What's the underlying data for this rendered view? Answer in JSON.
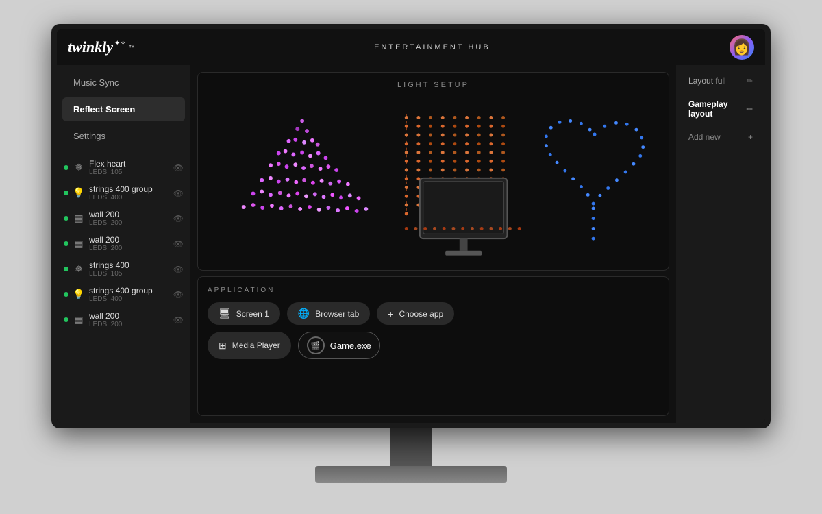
{
  "header": {
    "logo": "twinkly",
    "title": "ENTERTAINMENT HUB"
  },
  "sidebar": {
    "nav": [
      {
        "id": "music-sync",
        "label": "Music Sync",
        "active": false
      },
      {
        "id": "reflect-screen",
        "label": "Reflect Screen",
        "active": true
      },
      {
        "id": "settings",
        "label": "Settings",
        "active": false
      }
    ],
    "devices": [
      {
        "name": "Flex heart",
        "leds": "LEDS: 105",
        "icon": "❄",
        "online": true
      },
      {
        "name": "strings 400 group",
        "leds": "LEDS: 400",
        "icon": "💡",
        "online": true
      },
      {
        "name": "wall 200",
        "leds": "LEDS: 200",
        "icon": "▦",
        "online": true
      },
      {
        "name": "wall 200",
        "leds": "LEDS: 200",
        "icon": "▦",
        "online": true
      },
      {
        "name": "strings 400",
        "leds": "LEDS: 105",
        "icon": "❄",
        "online": true
      },
      {
        "name": "strings 400 group",
        "leds": "LEDS: 400",
        "icon": "💡",
        "online": true
      },
      {
        "name": "wall 200",
        "leds": "LEDS: 200",
        "icon": "▦",
        "online": true
      }
    ]
  },
  "layout": {
    "items": [
      {
        "id": "layout-full",
        "label": "Layout full",
        "active": false
      },
      {
        "id": "gameplay-layout",
        "label": "Gameplay layout",
        "active": true
      }
    ],
    "add_label": "Add new"
  },
  "light_setup": {
    "title": "LIGHT SETUP"
  },
  "application": {
    "title": "APPLICATION",
    "buttons_row1": [
      {
        "id": "screen1",
        "label": "Screen 1",
        "icon": "🖥"
      },
      {
        "id": "browser-tab",
        "label": "Browser tab",
        "icon": "🌐"
      },
      {
        "id": "choose-app",
        "label": "Choose app",
        "icon": "+"
      }
    ],
    "buttons_row2": [
      {
        "id": "media-player",
        "label": "Media Player",
        "icon": "⊞"
      },
      {
        "id": "game-exe",
        "label": "Game.exe",
        "icon": "🎬",
        "active": true
      }
    ]
  }
}
